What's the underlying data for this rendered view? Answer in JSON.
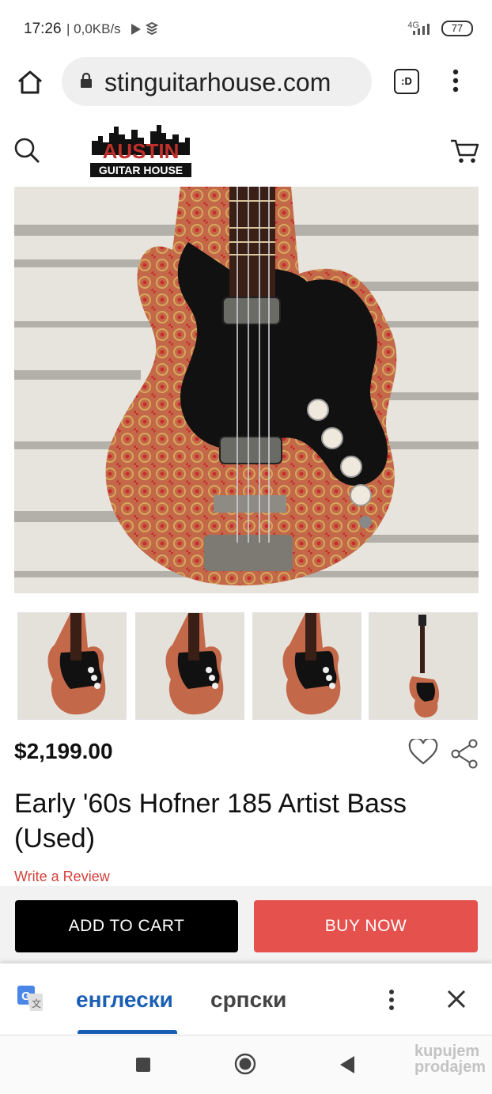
{
  "status_bar": {
    "time": "17:26",
    "speed": "| 0,0KB/s",
    "network": "4G",
    "battery": "77"
  },
  "browser": {
    "url": "stinguitarhouse.com",
    "tabs_label": ":D"
  },
  "site": {
    "logo_line1": "AUSTIN",
    "logo_line2": "GUITAR HOUSE"
  },
  "product": {
    "price": "$2,199.00",
    "title": "Early '60s Hofner 185 Artist Bass (Used)",
    "review_link": "Write a Review",
    "add_to_cart": "ADD TO CART",
    "buy_now": "BUY NOW"
  },
  "translate": {
    "source_lang": "енглески",
    "target_lang": "српски"
  },
  "watermark": {
    "line1": "kupujem",
    "line2": "prodajem"
  },
  "colors": {
    "accent_red": "#e5514d",
    "translate_blue": "#1a5fb4"
  }
}
